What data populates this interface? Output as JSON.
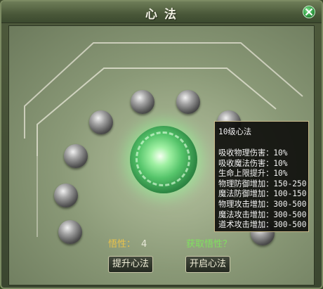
{
  "window": {
    "title": "心  法"
  },
  "icons": {
    "close": "close-icon"
  },
  "insight": {
    "label": "悟性：",
    "value": "4",
    "get_link": "获取悟性？"
  },
  "buttons": {
    "upgrade": "提升心法",
    "enable": "开启心法"
  },
  "tooltip": {
    "title": "10级心法",
    "lines": [
      "吸收物理伤害：10%",
      "吸收魔法伤害：10%",
      "生命上限提升：10%",
      "物理防御增加：150-250",
      "魔法防御增加：100-150",
      "物理攻击增加：300-500",
      "魔法攻击增加：300-500",
      "道术攻击增加：300-500"
    ]
  },
  "colors": {
    "accent_gold": "#e9c24a",
    "link_green": "#7fe05e",
    "core_glow": "#9ff0a2"
  }
}
